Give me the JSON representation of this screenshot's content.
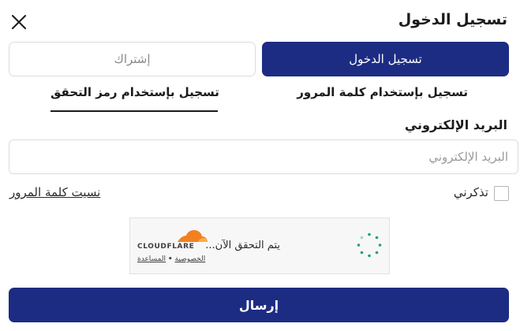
{
  "header": {
    "title": "تسجيل الدخول",
    "close_icon": "close-icon"
  },
  "tabs": {
    "login": "تسجيل الدخول",
    "signup": "إشتراك"
  },
  "methods": {
    "password": "تسجيل بإستخدام كلمة المرور",
    "code": "تسجيل بإستخدام رمز التحقق"
  },
  "form": {
    "email_label": "البريد الإلكتروني",
    "email_placeholder": "البريد الإلكتروني",
    "email_value": "",
    "remember_label": "تذكرني",
    "forgot_link": "نسيت كلمة المرور",
    "submit_label": "إرسال"
  },
  "captcha": {
    "status_text": "يتم التحقق الآن...",
    "brand": "CLOUDFLARE",
    "privacy_link": "الخصوصية",
    "separator": "•",
    "help_link": "المساعدة"
  },
  "colors": {
    "primary": "#1d2c83",
    "cloudflare_orange": "#f38020",
    "spinner_green": "#20a46b"
  }
}
